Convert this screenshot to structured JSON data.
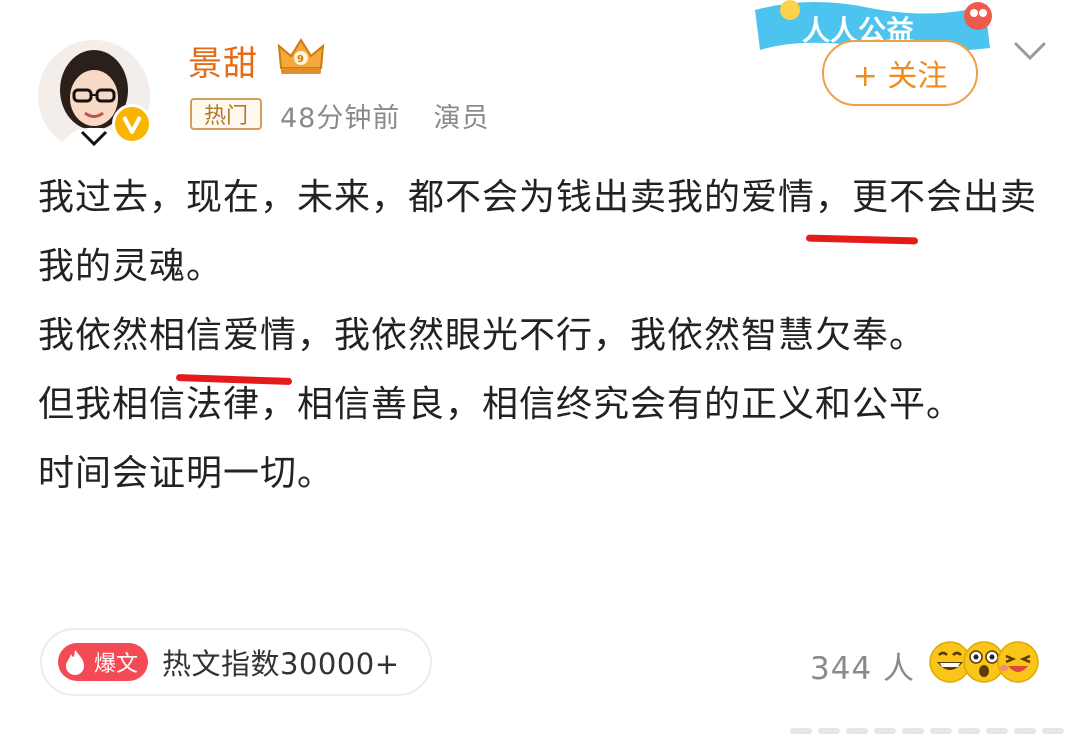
{
  "user": {
    "name": "景甜",
    "tag": "热门",
    "time": "48分钟前",
    "role": "演员"
  },
  "follow": {
    "label": "+ 关注"
  },
  "banner": {
    "text": "人人公益"
  },
  "post": {
    "paragraphs": [
      "我过去，现在，未来，都不会为钱出卖我的爱情，更不会出卖我的灵魂。",
      "我依然相信爱情，我依然眼光不行，我依然智慧欠奉。",
      "但我相信法律，相信善良，相信终究会有的正义和公平。",
      "时间会证明一切。"
    ]
  },
  "footer": {
    "badge": "爆文",
    "hot_index": "热文指数30000+",
    "reaction_count": "344 人"
  },
  "colors": {
    "brand": "#e56b17",
    "follow": "#f08b1c",
    "underline": "#e31b1b",
    "badge": "#f44a55"
  },
  "icons": [
    "crown-badge-icon",
    "verified-v-icon",
    "chevron-down-icon",
    "flame-icon",
    "grin-emoji-icon",
    "surprised-emoji-icon",
    "laugh-emoji-icon"
  ]
}
